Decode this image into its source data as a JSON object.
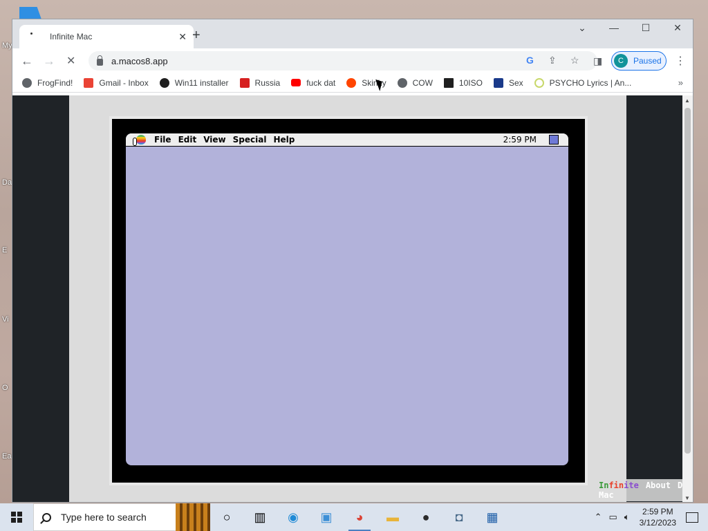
{
  "desktop": {
    "icon_labels": [
      "My",
      "Da",
      "E",
      "Vi",
      "O",
      "Ea"
    ]
  },
  "browser": {
    "tab": {
      "title": "Infinite Mac",
      "close": "✕"
    },
    "new_tab": "+",
    "window_controls": {
      "dropdown": "⌄",
      "minimize": "—",
      "maximize": "☐",
      "close": "✕"
    },
    "nav": {
      "back": "←",
      "forward": "→",
      "reload": "✕"
    },
    "url": "a.macos8.app",
    "profile": {
      "initial": "C",
      "status": "Paused"
    },
    "menu": "⋮",
    "bookmarks": [
      {
        "label": "FrogFind!",
        "icon": "globe-icon",
        "color": "#5f6368"
      },
      {
        "label": "Gmail - Inbox",
        "icon": "gmail-icon",
        "color": "#ea4335"
      },
      {
        "label": "Win11 installer",
        "icon": "github-icon",
        "color": "#1f1f1f"
      },
      {
        "label": "Russia",
        "icon": "russia-icon",
        "color": "#d62020"
      },
      {
        "label": "fuck dat",
        "icon": "youtube-icon",
        "color": "#ff0000"
      },
      {
        "label": "Skinky",
        "icon": "reddit-icon",
        "color": "#ff4500"
      },
      {
        "label": "COW",
        "icon": "globe-icon",
        "color": "#5f6368"
      },
      {
        "label": "10ISO",
        "icon": "building-icon",
        "color": "#1f1f1f"
      },
      {
        "label": "Sex",
        "icon": "s-logo-icon",
        "color": "#1a3a8a"
      },
      {
        "label": "PSYCHO Lyrics | An...",
        "icon": "loading-icon",
        "color": "#c8d86a"
      }
    ],
    "bookmarks_more": "»"
  },
  "mac": {
    "menus": [
      "File",
      "Edit",
      "View",
      "Special",
      "Help"
    ],
    "time": "2:59 PM",
    "desktop_color": "#b2b2da"
  },
  "page_footer": {
    "logo_letters": [
      "In",
      "fin",
      "ite",
      " ",
      "Mac"
    ],
    "logo_colors": [
      "#3a9a3a",
      "#e8412b",
      "#8a4ccf",
      "#ffffff",
      "#ffffff"
    ],
    "links": [
      "About",
      "Donate"
    ]
  },
  "taskbar": {
    "search_placeholder": "Type here to search",
    "clock_time": "2:59 PM",
    "clock_date": "3/12/2023",
    "apps": [
      "cortana-icon",
      "task-view-icon",
      "edge-icon",
      "photos-icon",
      "chrome-icon",
      "file-explorer-icon",
      "obs-icon",
      "camera-icon",
      "calculator-icon"
    ]
  }
}
